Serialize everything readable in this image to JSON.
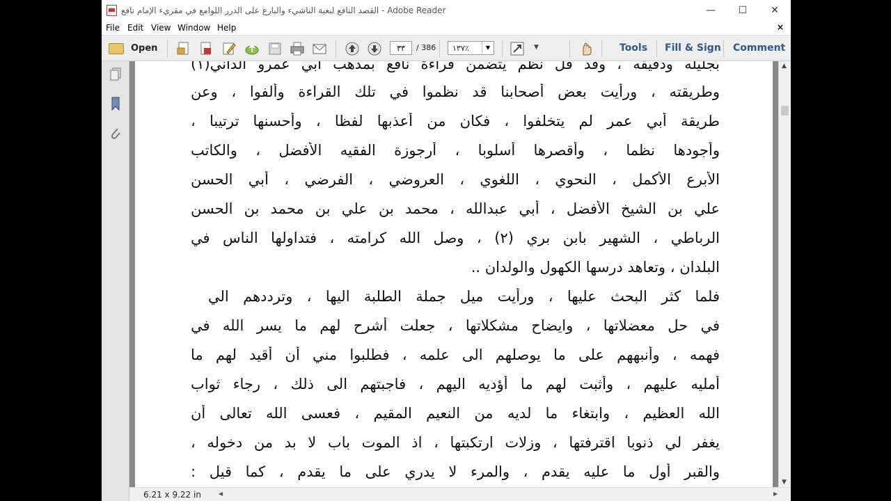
{
  "window": {
    "title": "القصد النافع لبغية الناشيء والبارع على الدرر اللوامع في مقريء الإمام نافع - Adobe Reader",
    "controls": {
      "minimize": "—",
      "maximize": "☐",
      "close": "✕"
    }
  },
  "menubar": {
    "items": [
      "File",
      "Edit",
      "View",
      "Window",
      "Help"
    ],
    "close": "×"
  },
  "toolbar": {
    "open_label": "Open",
    "current_page": "٣٣",
    "total_pages": "/ 386",
    "zoom": "١٣٧٪",
    "tools_label": "Tools",
    "fill_sign_label": "Fill & Sign",
    "comment_label": "Comment"
  },
  "document": {
    "lines": [
      "بجليله ودقيقه ، وقد قل نظم يتضمن قراءة نافع بمذهب أبي عمرو الداني(١)",
      "وطريقته ، ورأيت بعض أصحابنا قد نظموا في تلك القراءة وألفوا ، وعن",
      "طريقة أبي عمر لم يتخلفوا ، فكان من أعذبها لفظا ، وأحسنها ترتيبا ،",
      "وأجودها نظما ، وأقصرها أسلوبا ، أرجوزة الفقيه الأفضل ، والكاتب",
      "الأبرع الأكمل ، النحوي ، اللغوي ، العروضي ، الفرضي ، أبي الحسن",
      "علي بن الشيخ الأفضل ، أبي عبدالله ، محمد بن علي بن محمد بن الحسن",
      "الرباطي ، الشهير بابن بري (٢) ، وصل الله كرامته ، فتداولها الناس في",
      "البلدان ، وتعاهد درسها الكهول والولدان ..",
      "فلما كثر البحث عليها ، ورأيت ميل جملة الطلبة اليها ، وترددهم الي",
      "في حل معضلاتها ، وايضاح مشكلاتها ، جعلت أشرح لهم ما يسر الله في",
      "فهمه ، وأنبههم على ما يوصلهم الى علمه ، فطلبوا مني أن أقيد لهم ما",
      "أمليه عليهم ، وأثبت لهم ما أؤديه اليهم ، فاجبتهم الى ذلك ، رجاء ثواب",
      "الله العظيم ، وابتغاء ما لديه من النعيم المقيم ، فعسى الله تعالى أن",
      "يغفر لي ذنوبا اقترفتها ، وزلات ارتكبتها ، اذ الموت باب لا بد من دخوله ،",
      "والقبر أول ما عليه يقدم ، والمرء لا يدري على ما يقدم ، كما قيل :"
    ]
  },
  "statusbar": {
    "page_size": "6.21 x 9.22 in"
  },
  "colors": {
    "link": "#2c5a8c",
    "toolbar_bg": "#eeeeee",
    "doc_bg": "#888888"
  }
}
